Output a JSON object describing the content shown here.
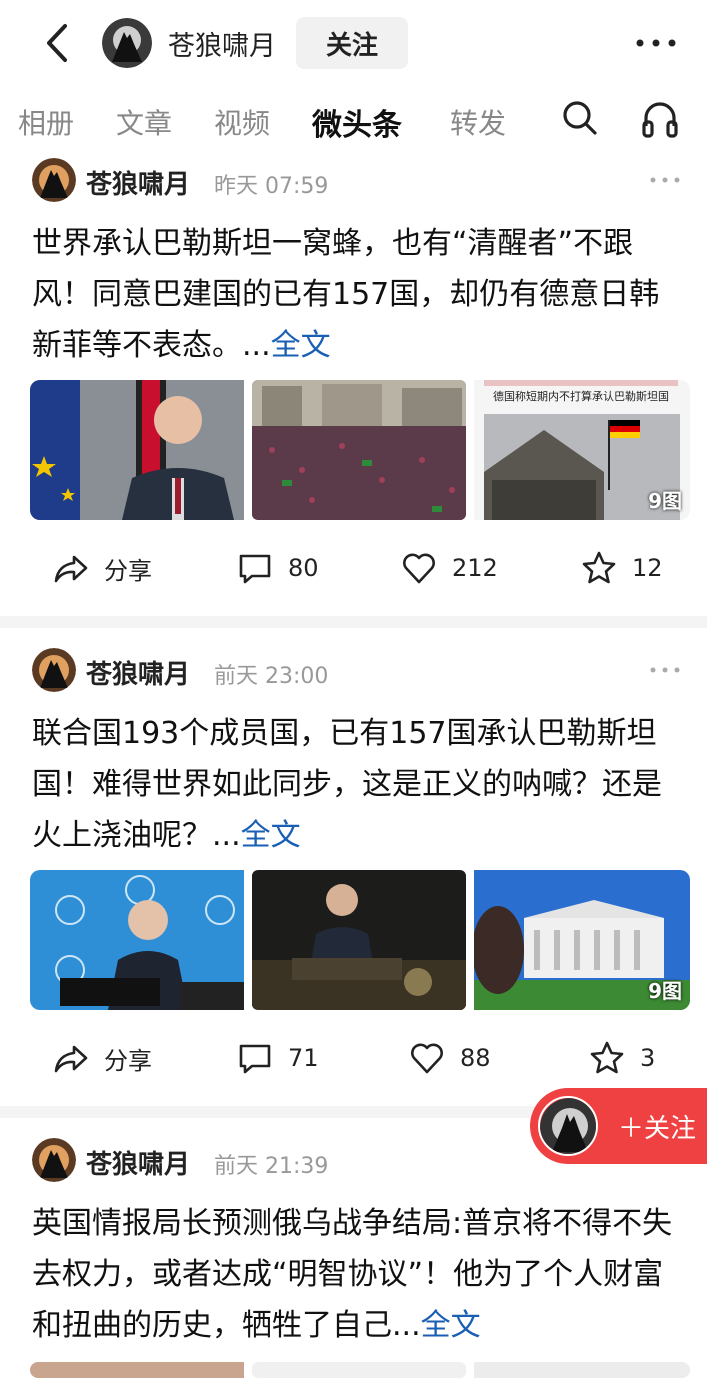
{
  "header": {
    "author_name": "苍狼啸月",
    "follow_label": "关注"
  },
  "tabs": [
    {
      "label": "相册"
    },
    {
      "label": "文章"
    },
    {
      "label": "视频"
    },
    {
      "label": "微头条",
      "active": true
    },
    {
      "label": "转发"
    }
  ],
  "icons": {
    "back": "back-icon",
    "more": "more-icon",
    "search": "search-icon",
    "audio": "headphones-icon",
    "share": "share-icon",
    "comment": "comment-icon",
    "like": "heart-icon",
    "favorite": "star-icon"
  },
  "colors": {
    "accent_blue": "#1a5fb4",
    "follow_red": "#f04142",
    "muted_gray": "#999999"
  },
  "posts": [
    {
      "author": "苍狼啸月",
      "time": "昨天  07:59",
      "text": "世界承认巴勒斯坦一窝蜂，也有“清醒者”不跟风！同意巴建国的已有157国，却仍有德意日韩新菲等不表态。...",
      "full_label": "全文",
      "image_caption": "德国称短期内不打算承认巴勒斯坦国",
      "image_count": "9图",
      "share_label": "分享",
      "comments": "80",
      "likes": "212",
      "favorites": "12"
    },
    {
      "author": "苍狼啸月",
      "time": "前天  23:00",
      "text": "联合国193个成员国，已有157国承认巴勒斯坦国！难得世界如此同步，这是正义的呐喊？还是火上浇油呢？...",
      "full_label": "全文",
      "image_count": "9图",
      "share_label": "分享",
      "comments": "71",
      "likes": "88",
      "favorites": "3"
    },
    {
      "author": "苍狼啸月",
      "time": "前天  21:39",
      "text": "英国情报局长预测俄乌战争结局:普京将不得不失去权力，或者达成“明智协议”！他为了个人财富和扭曲的历史，牺牲了自己...",
      "full_label": "全文"
    }
  ],
  "float_follow": {
    "label": "＋关注"
  }
}
